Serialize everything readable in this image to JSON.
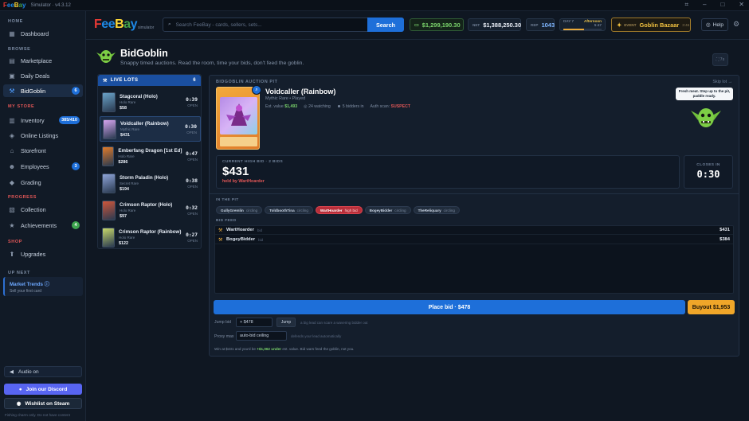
{
  "titlebar": {
    "logo_letters": [
      "F",
      "e",
      "e",
      "B",
      "a",
      "y"
    ],
    "subtitle": "Simulator · v4.3.12"
  },
  "sidebar": {
    "sections": {
      "home": "HOME",
      "browse": "BROWSE",
      "my_store": "MY STORE",
      "progress": "PROGRESS",
      "shop": "SHOP",
      "up_next": "UP NEXT"
    },
    "items": [
      {
        "label": "Dashboard",
        "icon": "dashboard-icon",
        "glyph": "▦"
      },
      {
        "label": "Marketplace",
        "icon": "marketplace-icon",
        "glyph": "▤"
      },
      {
        "label": "Daily Deals",
        "icon": "calendar-icon",
        "glyph": "▣"
      },
      {
        "label": "BidGoblin",
        "icon": "gavel-icon",
        "glyph": "⚒",
        "badge": "6"
      },
      {
        "label": "Inventory",
        "icon": "box-icon",
        "glyph": "▥",
        "badge": "385/410"
      },
      {
        "label": "Online Listings",
        "icon": "tag-icon",
        "glyph": "◈"
      },
      {
        "label": "Storefront",
        "icon": "store-icon",
        "glyph": "⌂"
      },
      {
        "label": "Employees",
        "icon": "people-icon",
        "glyph": "☻",
        "badge": "3"
      },
      {
        "label": "Grading",
        "icon": "shield-icon",
        "glyph": "◆"
      },
      {
        "label": "Collection",
        "icon": "collection-icon",
        "glyph": "▧"
      },
      {
        "label": "Achievements",
        "icon": "trophy-icon",
        "glyph": "★",
        "badge": "4"
      },
      {
        "label": "Upgrades",
        "icon": "upgrade-icon",
        "glyph": "⬆"
      }
    ],
    "up_next": {
      "title": "Market Trends",
      "subtitle": "Sell your first card"
    },
    "audio_label": "Audio on",
    "discord_label": "Join our Discord",
    "steam_label": "Wishlist on Steam",
    "footer": "Fishing charm only. Do not have content"
  },
  "topbar": {
    "logo_sub": "simulator",
    "search_placeholder": "Search FeeBay - cards, sellers, sets...",
    "search_button": "Search",
    "cash": "$1,299,190.30",
    "net_label": "NET",
    "net": "$1,388,250.30",
    "rep_label": "REP",
    "rep": "1043",
    "day_label": "DAY 7",
    "day_phase": "Afternoon",
    "day_time": "5:47",
    "day_progress": 0.55,
    "event_label": "EVENT",
    "event_name": "Goblin Bazaar",
    "event_sub": "3:46",
    "help_label": "Help"
  },
  "page": {
    "title": "BidGoblin",
    "subtitle": "Snappy timed auctions. Read the room, time your bids, don't feed the goblin.",
    "corner_button": "⛶ 7s"
  },
  "live_lots": {
    "header": "LIVE LOTS",
    "count": "6",
    "lots": [
      {
        "name": "Stagcoral (Holo)",
        "rarity": "Holo Rare",
        "price": "$58",
        "time": "0:39",
        "status": "OPEN",
        "color": "#6aa3c8"
      },
      {
        "name": "Voidcaller (Rainbow)",
        "rarity": "Mythic Rare",
        "price": "$431",
        "time": "0:30",
        "status": "OPEN",
        "color": "#d6a5f0"
      },
      {
        "name": "Emberfang Dragon [1st Ed]",
        "rarity": "Holo Rare",
        "price": "$286",
        "time": "0:47",
        "status": "OPEN",
        "color": "#e07b2a"
      },
      {
        "name": "Storm Paladin (Holo)",
        "rarity": "Secret Rare",
        "price": "$194",
        "time": "0:38",
        "status": "OPEN",
        "color": "#8ea4d8"
      },
      {
        "name": "Crimson Raptor (Holo)",
        "rarity": "Holo Rare",
        "price": "$97",
        "time": "0:32",
        "status": "OPEN",
        "color": "#d0563a"
      },
      {
        "name": "Crimson Raptor (Rainbow)",
        "rarity": "Holo Rare",
        "price": "$122",
        "time": "0:27",
        "status": "OPEN",
        "color": "#c7d86a"
      }
    ]
  },
  "pit": {
    "header": "BIDGOBLIN AUCTION PIT",
    "skip": "Skip lot →",
    "card_name": "Voidcaller (Rainbow)",
    "card_rarity": "Mythic Rare • Played",
    "est_label": "Est. value",
    "est_value": "$1,493",
    "watching": "24 watching",
    "bidders": "5 bidders in",
    "auth_label": "Auth scan:",
    "auth_value": "SUSPECT",
    "speech": "Fresh meat. Step up to the pit, paddle ready.",
    "high_bid_label": "CURRENT HIGH BID · 2 BIDS",
    "high_bid": "$431",
    "high_bidder": "held by WartHoarder",
    "closes_label": "CLOSES IN",
    "closes_time": "0:30",
    "in_pit_label": "IN THE PIT",
    "bidders_list": [
      {
        "name": "GullyGremlin",
        "state": "circling",
        "hot": false
      },
      {
        "name": "ToldboothTina",
        "state": "circling",
        "hot": false
      },
      {
        "name": "WartHoarder",
        "state": "high bid",
        "hot": true
      },
      {
        "name": "BogeyBidder",
        "state": "circling",
        "hot": false
      },
      {
        "name": "TheReliquary",
        "state": "circling",
        "hot": false
      }
    ],
    "feed_label": "BID FEED",
    "feed": [
      {
        "name": "WartHoarder",
        "tag": "bid",
        "amount": "$431"
      },
      {
        "name": "BogeyBidder",
        "tag": "bid",
        "amount": "$384"
      }
    ],
    "place_bid": "Place bid · $478",
    "buyout": "Buyout $1,953",
    "jump_label": "Jump bid",
    "jump_value": "+ $478",
    "jump_button": "Jump",
    "jump_hint": "a big lead can scare a wavering bidder out",
    "proxy_label": "Proxy max",
    "proxy_placeholder": "auto-bid ceiling",
    "proxy_hint": "defends your lead automatically",
    "outcome_prefix": "Win at $431 and you'd be",
    "outcome_value": "+$1,062 under",
    "outcome_suffix": "est. value. Bid wars feed the goblin, not you."
  }
}
